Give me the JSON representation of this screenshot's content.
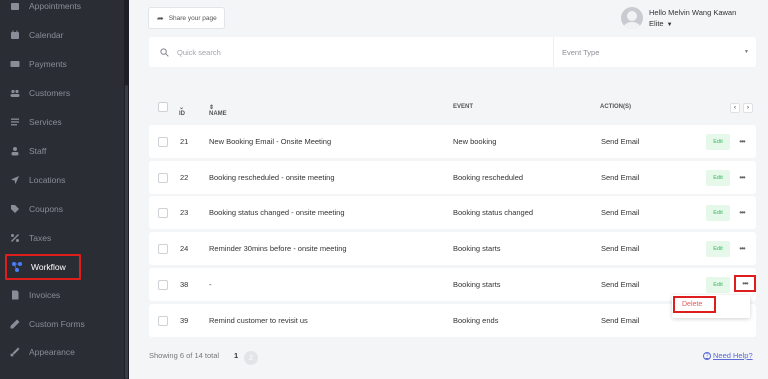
{
  "sidebar": {
    "items": [
      {
        "label": "Appointments",
        "icon": "appointments-icon"
      },
      {
        "label": "Calendar",
        "icon": "calendar-icon"
      },
      {
        "label": "Payments",
        "icon": "payments-icon"
      },
      {
        "label": "Customers",
        "icon": "customers-icon"
      },
      {
        "label": "Services",
        "icon": "services-icon"
      },
      {
        "label": "Staff",
        "icon": "staff-icon"
      },
      {
        "label": "Locations",
        "icon": "locations-icon"
      },
      {
        "label": "Coupons",
        "icon": "coupons-icon"
      },
      {
        "label": "Taxes",
        "icon": "taxes-icon"
      },
      {
        "label": "Workflow",
        "icon": "workflow-icon",
        "active": true
      },
      {
        "label": "Invoices",
        "icon": "invoices-icon"
      },
      {
        "label": "Custom Forms",
        "icon": "custom-forms-icon"
      },
      {
        "label": "Appearance",
        "icon": "appearance-icon"
      }
    ]
  },
  "header": {
    "share_label": "Share your page",
    "user_greeting": "Hello Melvin Wang Kawan",
    "user_plan": "Elite"
  },
  "filters": {
    "search_placeholder": "Quick search",
    "event_type_label": "Event Type"
  },
  "table": {
    "columns": {
      "id": "ID",
      "name": "NAME",
      "event": "EVENT",
      "actions": "ACTION(S)"
    },
    "edit_label": "Edit",
    "more_label": "•••",
    "rows": [
      {
        "id": "21",
        "name": "New Booking Email - Onsite Meeting",
        "event": "New booking",
        "action": "Send Email"
      },
      {
        "id": "22",
        "name": "Booking rescheduled - onsite meeting",
        "event": "Booking rescheduled",
        "action": "Send Email"
      },
      {
        "id": "23",
        "name": "Booking status changed - onsite meeting",
        "event": "Booking status changed",
        "action": "Send Email"
      },
      {
        "id": "24",
        "name": "Reminder 30mins before - onsite meeting",
        "event": "Booking starts",
        "action": "Send Email"
      },
      {
        "id": "38",
        "name": "-",
        "event": "Booking starts",
        "action": "Send Email"
      },
      {
        "id": "39",
        "name": "Remind customer to revisit us",
        "event": "Booking ends",
        "action": "Send Email"
      }
    ]
  },
  "dropdown": {
    "delete_label": "Delete"
  },
  "footer": {
    "summary": "Showing 6 of 14 total",
    "page_current": "1",
    "page_next": "2",
    "help_label": "Need Help?"
  },
  "colors": {
    "highlight": "#e01d1d",
    "accent": "#4a7cf7",
    "edit_bg": "#e6f8ea",
    "edit_text": "#35b45a"
  }
}
